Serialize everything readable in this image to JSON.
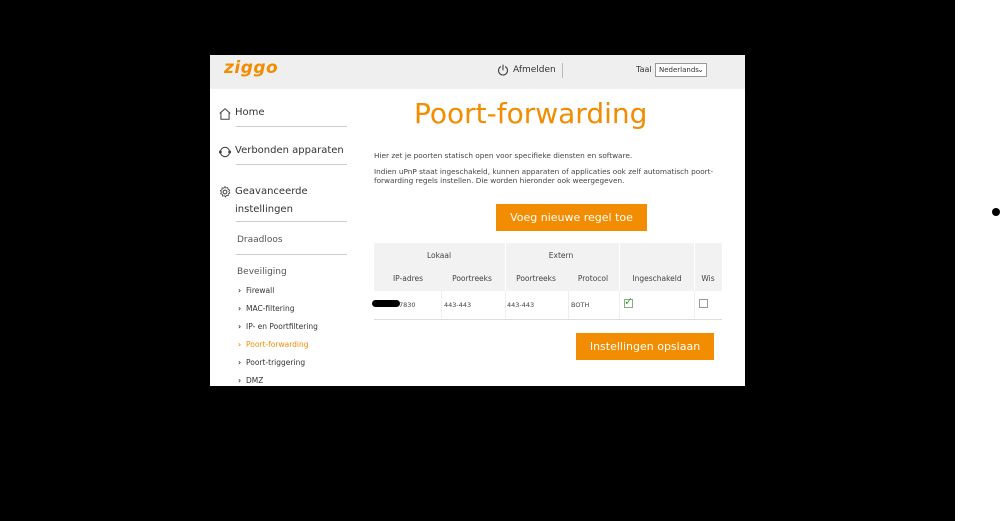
{
  "header": {
    "logo": "ziggo",
    "logout_label": "Afmelden",
    "language_label": "Taal",
    "language_selected": "Nederlands"
  },
  "sidebar": {
    "home": "Home",
    "connected_devices": "Verbonden apparaten",
    "advanced_line1": "Geavanceerde",
    "advanced_line2": "instellingen",
    "wireless": "Draadloos",
    "security": "Beveiliging",
    "items": [
      "Firewall",
      "MAC-filtering",
      "IP- en Poortfiltering",
      "Poort-forwarding",
      "Poort-triggering",
      "DMZ"
    ],
    "active_item": "Poort-forwarding"
  },
  "main": {
    "title": "Poort-forwarding",
    "description1": "Hier zet je poorten statisch open voor specifieke diensten en software.",
    "description2": "Indien uPnP staat ingeschakeld, kunnen apparaten of applicaties ook zelf automatisch poort-forwarding regels instellen. Die worden hieronder ook weergegeven.",
    "add_rule_button": "Voeg nieuwe regel toe",
    "save_button": "Instellingen opslaan"
  },
  "table": {
    "group_local": "Lokaal",
    "group_external": "Extern",
    "columns": [
      "IP-adres",
      "Poortreeks",
      "Poortreeks",
      "Protocol",
      "Ingeschakeld",
      "Wis"
    ],
    "rows": [
      {
        "ip_suffix": "7830",
        "local_range": "443-443",
        "external_range": "443-443",
        "protocol": "BOTH",
        "enabled": true,
        "delete": false
      }
    ]
  },
  "colors": {
    "accent": "#f28c00",
    "topbar": "#efefef",
    "table_header": "#f2f2f2"
  }
}
